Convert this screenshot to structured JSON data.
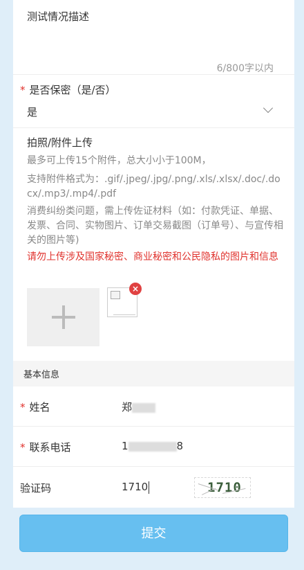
{
  "description_field": {
    "placeholder": "测试情况描述",
    "counter": "6/800字以内"
  },
  "secret_field": {
    "required_mark": "*",
    "label": "是否保密（是/否）",
    "selected_value": "是"
  },
  "upload": {
    "title": "拍照/附件上传",
    "rule_count": "最多可上传15个附件，总大小小于100M，",
    "rule_formats": "支持附件格式为：.gif/.jpeg/.jpg/.png/.xls/.xlsx/.doc/.docx/.mp3/.mp4/.pdf",
    "rule_dispute": "消费纠纷类问题，需上传佐证材料（如：付款凭证、单据、发票、合同、实物图片、订单交易截图（订单号）、与宣传相关的图片等)",
    "warning": "请勿上传涉及国家秘密、商业秘密和公民隐私的图片和信息"
  },
  "basic_info": {
    "section_title": "基本信息",
    "name": {
      "required_mark": "*",
      "label": "姓名",
      "value_visible": "郑"
    },
    "phone": {
      "required_mark": "*",
      "label": "联系电话",
      "value_prefix": "1",
      "value_suffix": "8"
    },
    "captcha": {
      "label": "验证码",
      "value": "1710",
      "image_text": "1710"
    }
  },
  "submit": {
    "label": "提交"
  },
  "colors": {
    "page_bg": "#dfeef9",
    "required": "#e0322d",
    "warning": "#e0322d",
    "submit_bg": "#67bff0"
  }
}
